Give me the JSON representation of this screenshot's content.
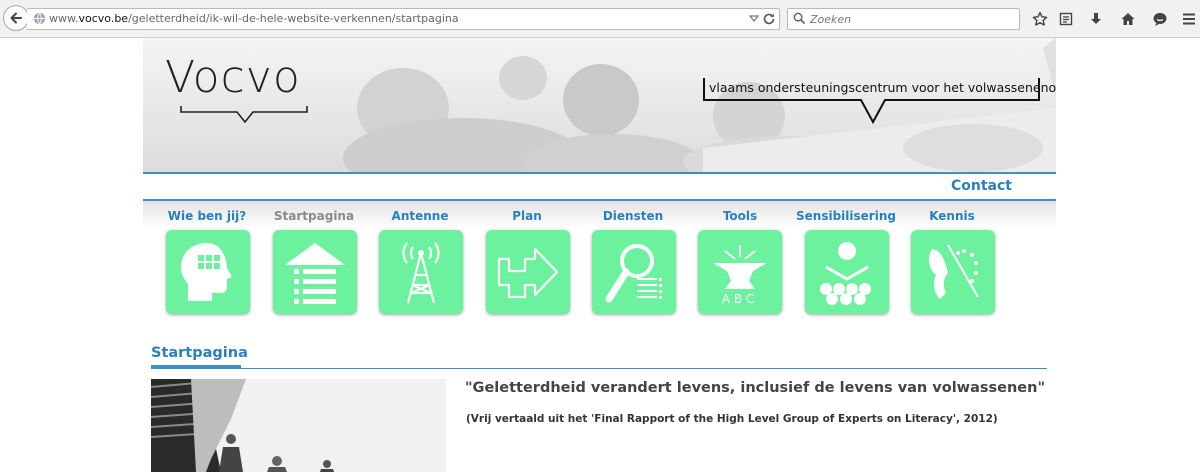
{
  "browser": {
    "url_prefix": "www.",
    "url_domain": "vocvo.be",
    "url_path": "/geletterdheid/ik-wil-de-hele-website-verkennen/startpagina",
    "search_placeholder": "Zoeken",
    "icons": [
      "back-arrow-icon",
      "globe-icon",
      "dropdown-icon",
      "reload-icon",
      "search-icon",
      "star-icon",
      "reading-list-icon",
      "download-icon",
      "home-icon",
      "chat-icon",
      "menu-icon"
    ]
  },
  "header": {
    "logo": "Vocvo",
    "tagline": "vlaams ondersteuningscentrum voor het volwassenenonderwijs",
    "contact": "Contact"
  },
  "nav": {
    "items": [
      {
        "label": "Wie ben jij?",
        "icon": "head-grid-icon"
      },
      {
        "label": "Startpagina",
        "icon": "house-list-icon",
        "active": true
      },
      {
        "label": "Antenne",
        "icon": "antenna-tower-icon"
      },
      {
        "label": "Plan",
        "icon": "arrow-path-icon"
      },
      {
        "label": "Diensten",
        "icon": "magnifier-list-icon"
      },
      {
        "label": "Tools",
        "icon": "anvil-abc-icon"
      },
      {
        "label": "Sensibilisering",
        "icon": "crowd-icon"
      },
      {
        "label": "Kennis",
        "icon": "lion-eu-flag-icon"
      }
    ],
    "tile_color": "#6cf29e",
    "label_color": "#2a80bf",
    "active_label_color": "#8a8a8a"
  },
  "main": {
    "section_title": "Startpagina",
    "quote": "\"Geletterdheid verandert levens, inclusief de levens van volwassenen\"",
    "source": "(Vrij vertaald uit het 'Final Rapport of the High Level Group of Experts on Literacy', 2012)"
  },
  "colors": {
    "accent": "#3c8fc9",
    "link": "#2a80bf"
  }
}
